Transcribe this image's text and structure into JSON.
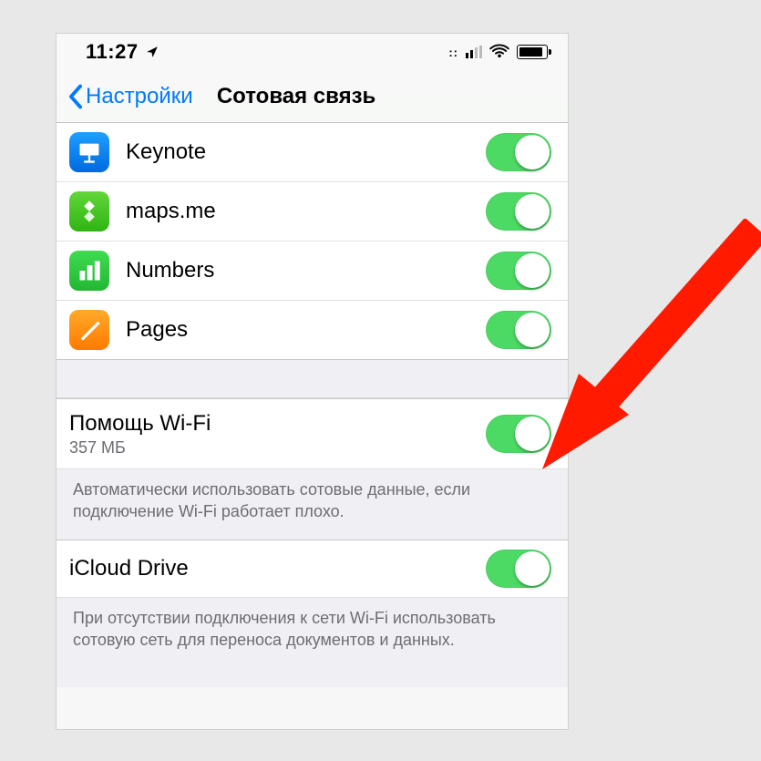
{
  "status": {
    "time": "11:27"
  },
  "nav": {
    "back_label": "Настройки",
    "title": "Сотовая связь"
  },
  "apps": [
    {
      "name": "Keynote"
    },
    {
      "name": "maps.me"
    },
    {
      "name": "Numbers"
    },
    {
      "name": "Pages"
    }
  ],
  "wifi_assist": {
    "title": "Помощь Wi-Fi",
    "subtitle": "357 МБ",
    "footer": "Автоматически использовать сотовые данные, если подключение Wi-Fi работает плохо."
  },
  "icloud_drive": {
    "title": "iCloud Drive",
    "footer": "При отсутствии подключения к сети Wi-Fi использовать сотовую сеть для переноса документов и данных."
  }
}
